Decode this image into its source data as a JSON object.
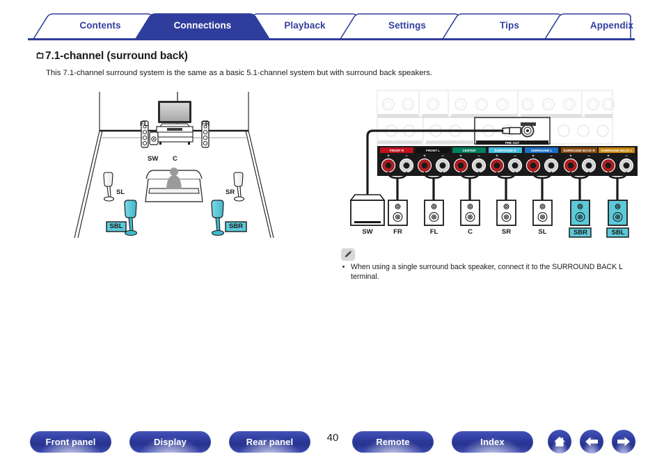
{
  "tabs": [
    {
      "label": "Contents",
      "active": false
    },
    {
      "label": "Connections",
      "active": true
    },
    {
      "label": "Playback",
      "active": false
    },
    {
      "label": "Settings",
      "active": false
    },
    {
      "label": "Tips",
      "active": false
    },
    {
      "label": "Appendix",
      "active": false
    }
  ],
  "heading": "7.1-channel (surround back)",
  "subtitle": "This 7.1-channel surround system is the same as a basic 5.1-channel system but with surround back speakers.",
  "room_diagram": {
    "labels": [
      "FL",
      "FR",
      "SW",
      "C",
      "SL",
      "SR",
      "SBL",
      "SBR"
    ],
    "highlight_color": "#5dc9d9",
    "highlighted": [
      "SBL",
      "SBR"
    ]
  },
  "panel_diagram": {
    "pre_out_label": "PRE OUT",
    "terminals": [
      {
        "label": "FRONT R",
        "color": "#c1121f",
        "channel": "R"
      },
      {
        "label": "FRONT L",
        "color": "#111111",
        "channel": "L"
      },
      {
        "label": "CENTER",
        "color": "#008060",
        "channel": ""
      },
      {
        "label": "SURROUND R",
        "color": "#45bde0",
        "channel": "R"
      },
      {
        "label": "SURROUND L",
        "color": "#1b6fc4",
        "channel": "L"
      },
      {
        "label": "SURROUND BACK R",
        "color": "#8a4a10",
        "channel": "R"
      },
      {
        "label": "SURROUND BACK L",
        "color": "#c8860d",
        "channel": "L"
      }
    ],
    "polarity": [
      "+",
      "-"
    ],
    "speakers": [
      {
        "label": "SW",
        "type": "subwoofer",
        "highlight": false
      },
      {
        "label": "FR",
        "type": "speaker",
        "highlight": false
      },
      {
        "label": "FL",
        "type": "speaker",
        "highlight": false
      },
      {
        "label": "C",
        "type": "speaker",
        "highlight": false
      },
      {
        "label": "SR",
        "type": "speaker",
        "highlight": false
      },
      {
        "label": "SL",
        "type": "speaker",
        "highlight": false
      },
      {
        "label": "SBR",
        "type": "speaker",
        "highlight": true
      },
      {
        "label": "SBL",
        "type": "speaker",
        "highlight": true
      }
    ]
  },
  "note": {
    "text": "When using a single surround back speaker, connect it to the SURROUND BACK L terminal."
  },
  "bottom_nav": {
    "buttons": [
      {
        "label": "Front panel"
      },
      {
        "label": "Display"
      },
      {
        "label": "Rear panel"
      },
      {
        "label": "Remote"
      },
      {
        "label": "Index"
      }
    ],
    "page_number": "40",
    "icons": [
      "home-icon",
      "arrow-left-icon",
      "arrow-right-icon"
    ]
  },
  "colors": {
    "brand_blue": "#333f9e",
    "highlight_cyan": "#5dc9d9"
  }
}
